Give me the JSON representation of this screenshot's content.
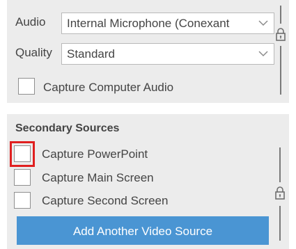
{
  "audio": {
    "label": "Audio",
    "value": "Internal Microphone (Conexant"
  },
  "quality": {
    "label": "Quality",
    "value": "Standard"
  },
  "capture_computer_audio": {
    "label": "Capture Computer Audio",
    "checked": false
  },
  "secondary_sources": {
    "title": "Secondary Sources",
    "items": [
      {
        "label": "Capture PowerPoint",
        "checked": false
      },
      {
        "label": "Capture Main Screen",
        "checked": false
      },
      {
        "label": "Capture Second Screen",
        "checked": false
      }
    ],
    "add_button_label": "Add Another Video Source"
  },
  "colors": {
    "panel_bg": "#ececec",
    "button_bg": "#4a95d3",
    "highlight": "#e01f1f"
  },
  "icons": [
    "chevron-down-icon",
    "lock-icon"
  ]
}
